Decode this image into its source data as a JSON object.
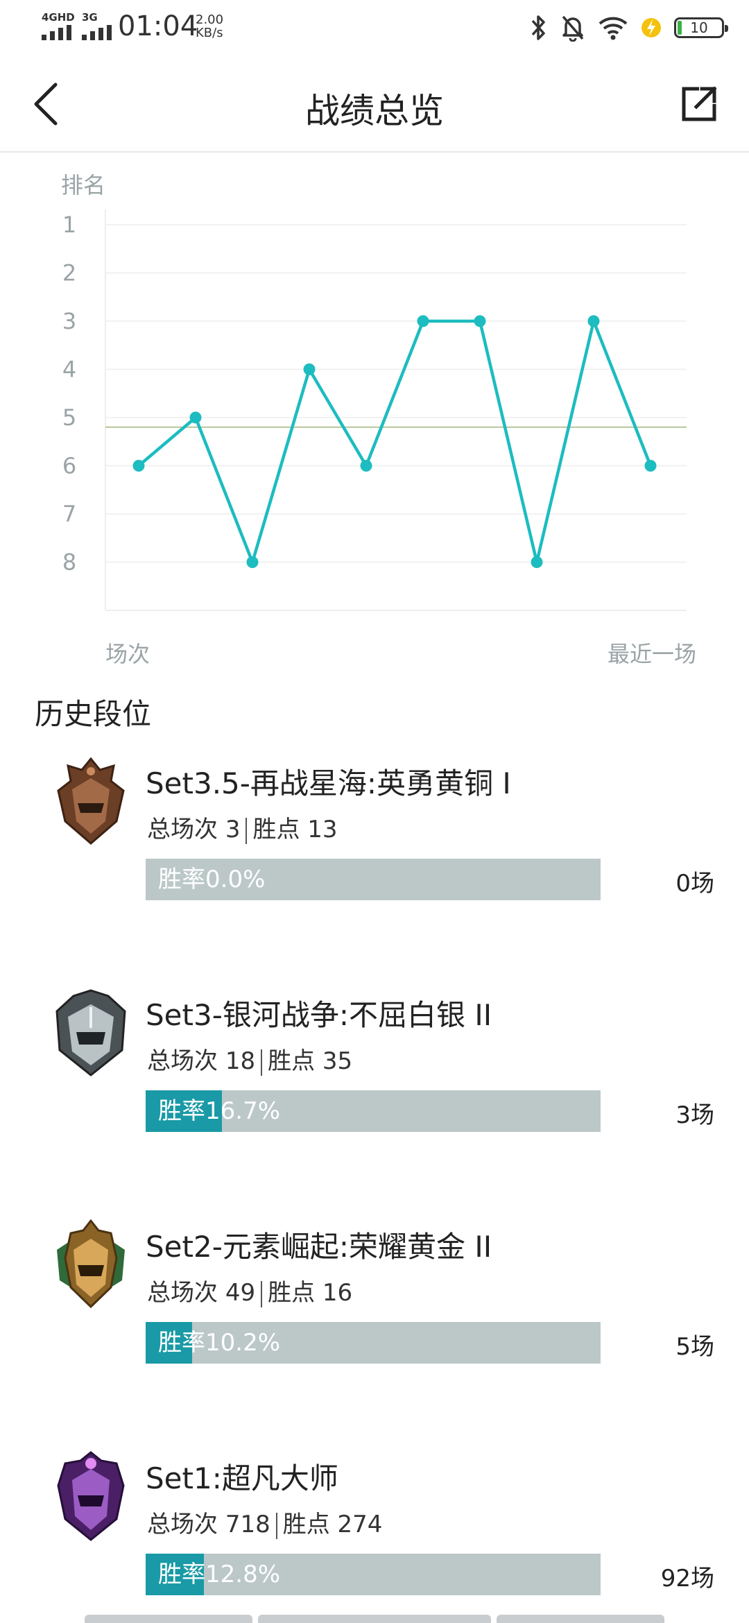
{
  "status_bar": {
    "network1": "4GHD",
    "network2": "3G",
    "time": "01:04",
    "speed_value": "2.00",
    "speed_unit": "KB/s",
    "battery": "10",
    "icons": [
      "bluetooth-icon",
      "bell-muted-icon",
      "wifi-icon",
      "charging-icon",
      "battery-icon"
    ]
  },
  "header": {
    "title": "战绩总览",
    "back_icon": "back-arrow-icon",
    "share_icon": "share-icon"
  },
  "chart_data": {
    "type": "line",
    "ylabel": "排名",
    "x_start_label": "场次",
    "x_end_label": "最近一场",
    "y_ticks": [
      "1",
      "2",
      "3",
      "4",
      "5",
      "6",
      "7",
      "8"
    ],
    "ylim": [
      1,
      8
    ],
    "y_inverted": true,
    "values": [
      6,
      5,
      8,
      4,
      6,
      3,
      3,
      8,
      3,
      6
    ],
    "average_line": 5.2,
    "color": "#1dbcc0",
    "average_color": "#b7c79b",
    "grid": true
  },
  "history": {
    "title": "历史段位",
    "stat_total_label": "总场次",
    "stat_points_label": "胜点",
    "winrate_label": "胜率",
    "items": [
      {
        "name": "Set3.5-再战星海:英勇黄铜 I",
        "total": "3",
        "points": "13",
        "rate_text": "0.0%",
        "rate": 0.0,
        "count": "0场",
        "emblem": "bronze-rank-emblem-icon",
        "color": "#8a5a3c"
      },
      {
        "name": "Set3-银河战争:不屈白银 II",
        "total": "18",
        "points": "35",
        "rate_text": "16.7%",
        "rate": 0.167,
        "count": "3场",
        "emblem": "silver-rank-emblem-icon",
        "color": "#7a8589"
      },
      {
        "name": "Set2-元素崛起:荣耀黄金 II",
        "total": "49",
        "points": "16",
        "rate_text": "10.2%",
        "rate": 0.102,
        "count": "5场",
        "emblem": "gold-rank-emblem-icon",
        "color": "#b88a3c"
      },
      {
        "name": "Set1:超凡大师",
        "total": "718",
        "points": "274",
        "rate_text": "12.8%",
        "rate": 0.128,
        "count": "92场",
        "emblem": "master-rank-emblem-icon",
        "color": "#7a3f9a"
      }
    ]
  }
}
